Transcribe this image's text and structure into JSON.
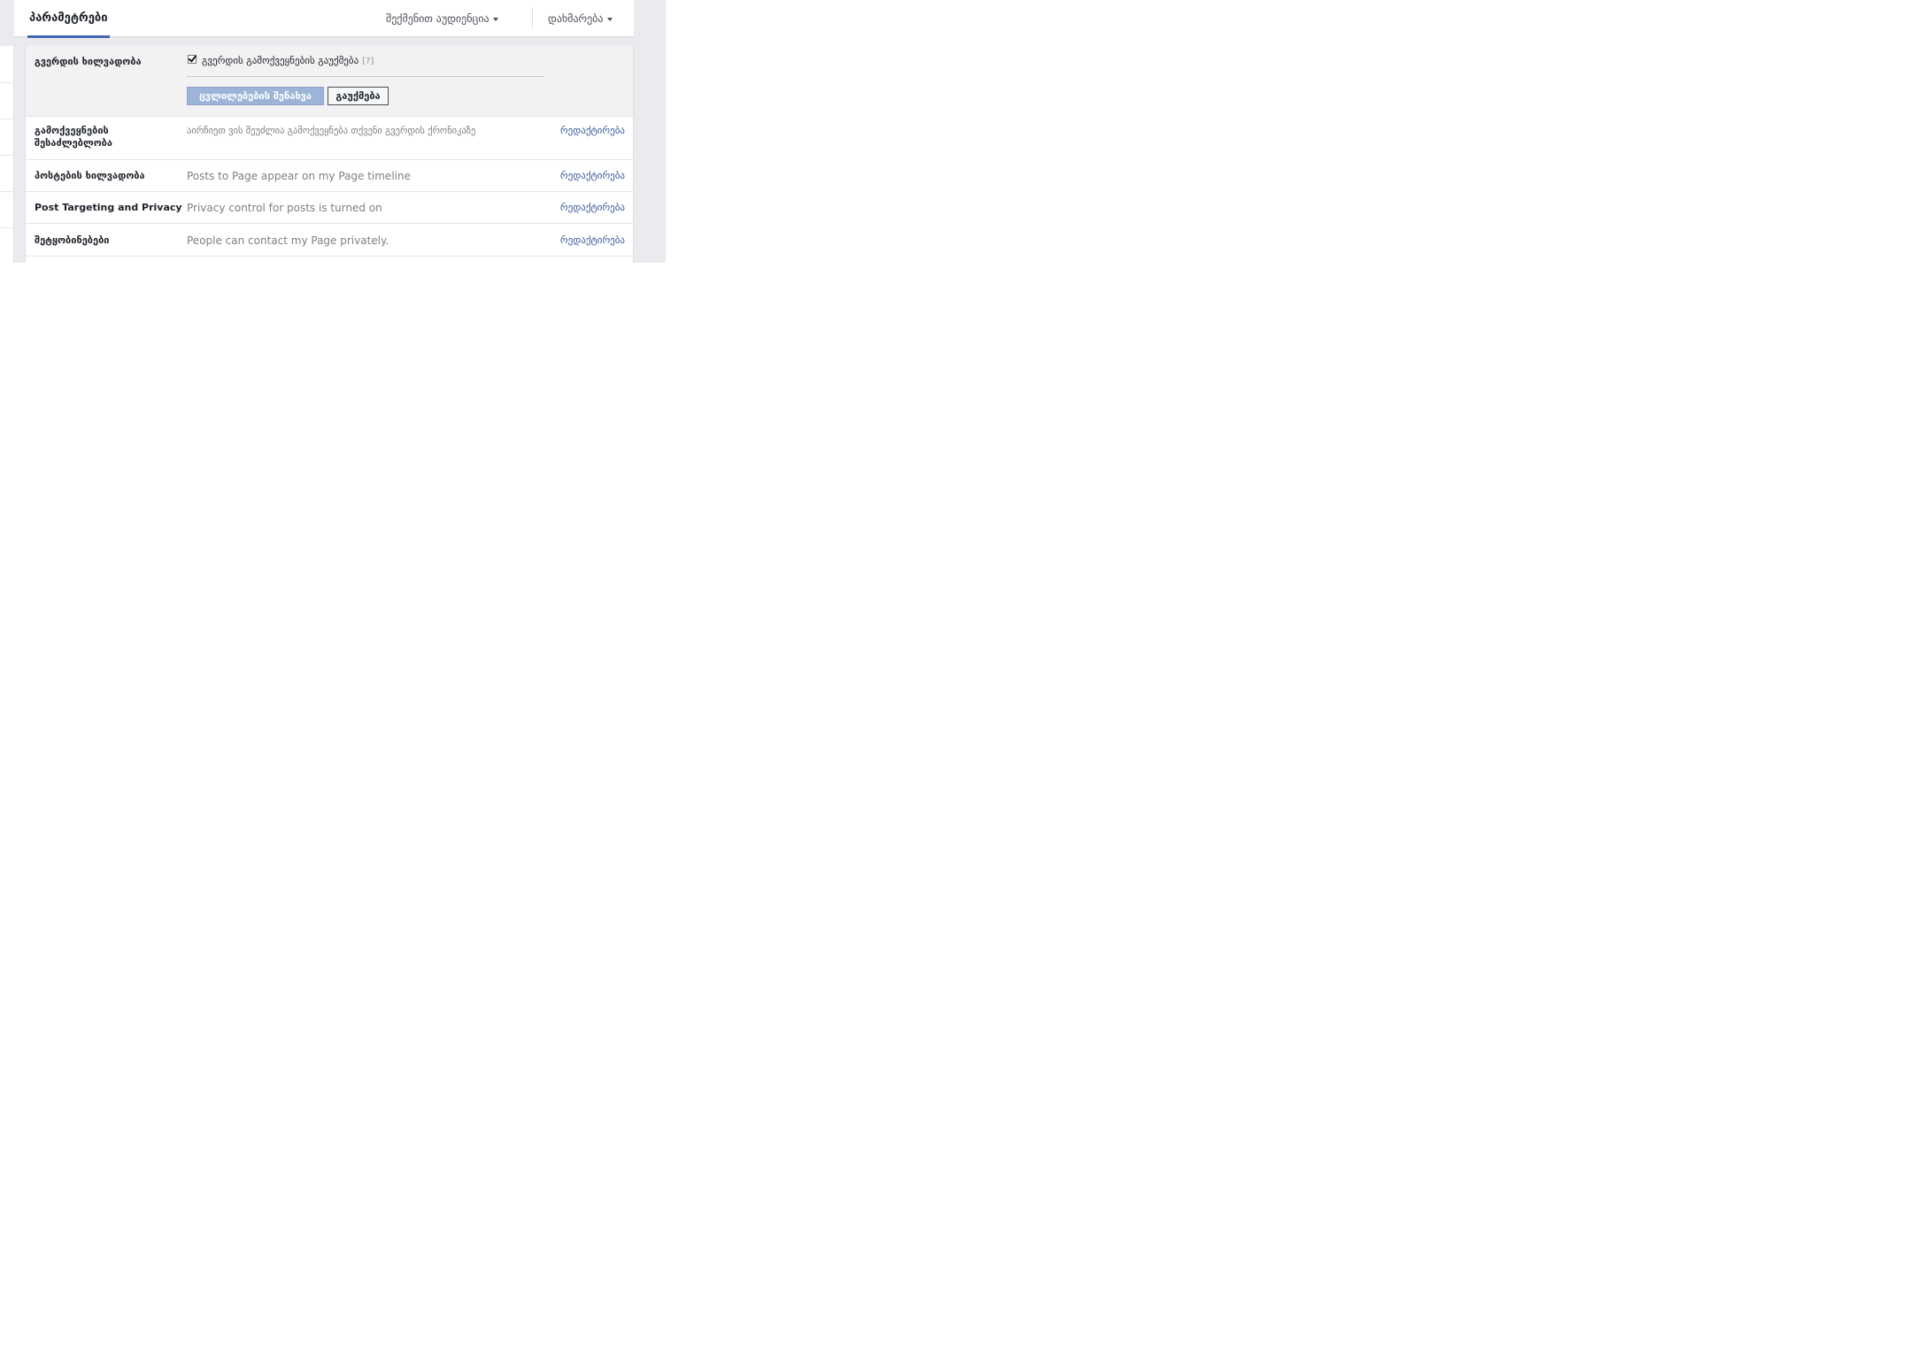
{
  "header": {
    "active_tab": "პარამეტრები",
    "menu_audience": "შექმენით აუდიენცია",
    "menu_help": "დახმარება"
  },
  "settings": {
    "visibility": {
      "label": "გვერდის ხილვადობა",
      "checkbox_label": "გვერდის გამოქვეყნების გაუქმება",
      "help": "[?]",
      "checked": true,
      "save_label": "ცვლილებების შენახვა",
      "cancel_label": "გაუქმება"
    },
    "rows": [
      {
        "label": "გამოქვეყნების შესაძლებლობა",
        "value": "აირჩიეთ ვის შეუძლია გამოქვეყნება თქვენი გვერდის ქრონიკაზე",
        "edit": "რედაქტირება"
      },
      {
        "label": "პოსტების ხილვადობა",
        "value": "Posts to Page appear on my Page timeline",
        "edit": "რედაქტირება"
      },
      {
        "label": "Post Targeting and Privacy",
        "value": "Privacy control for posts is turned on",
        "edit": "რედაქტირება"
      },
      {
        "label": "შეტყობინებები",
        "value": "People can contact my Page privately.",
        "edit": "რედაქტირება"
      }
    ]
  },
  "colors": {
    "accent": "#4267b2",
    "link": "#365899",
    "save_button": "#9cb4d8"
  }
}
